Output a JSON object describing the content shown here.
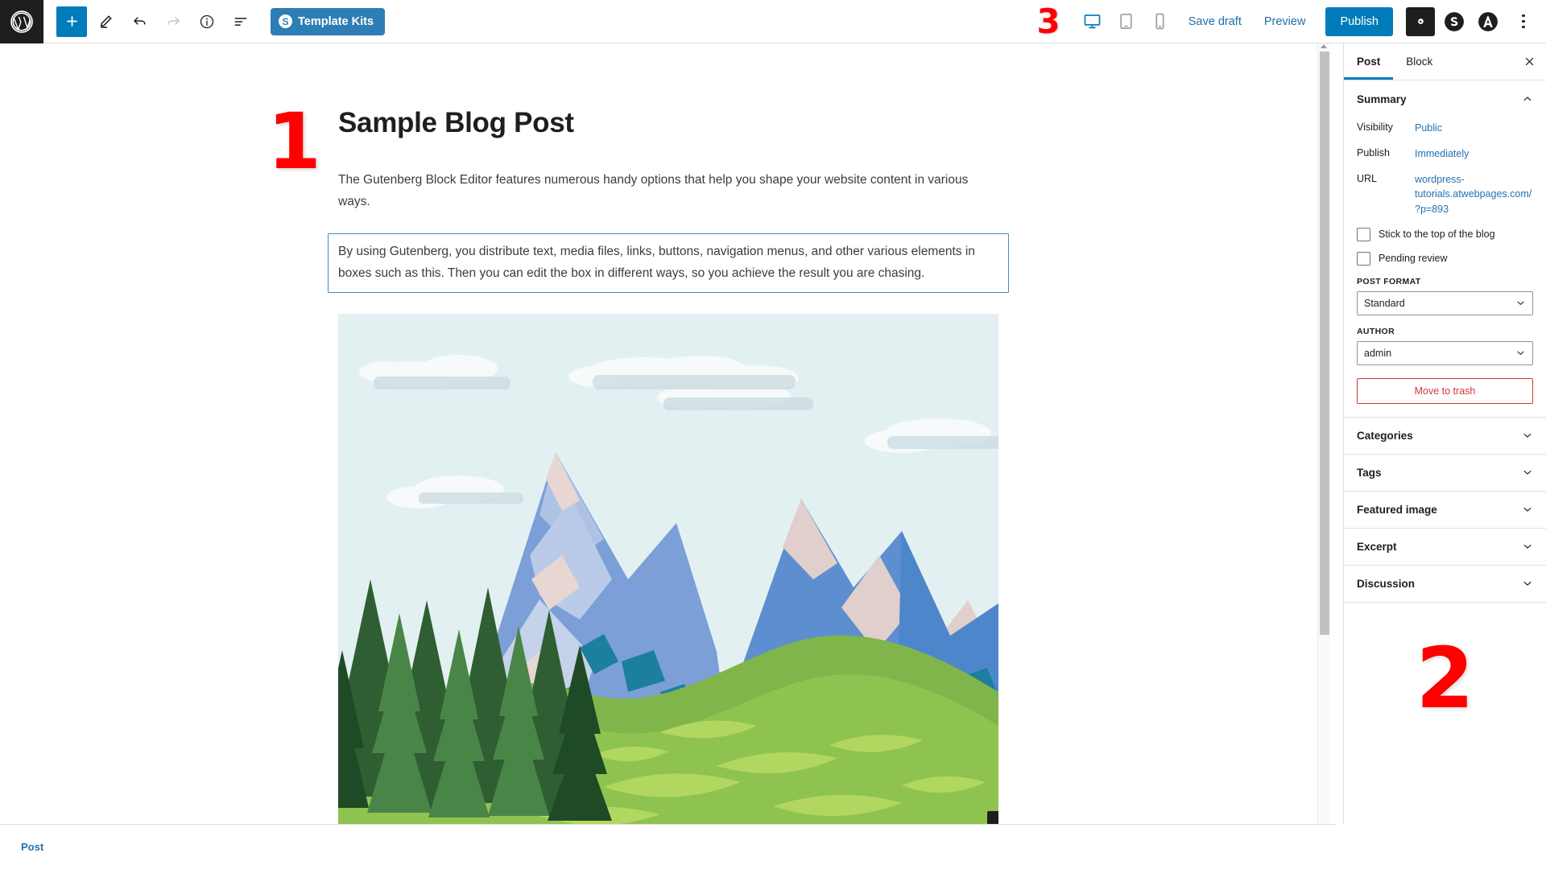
{
  "toolbar": {
    "logo_icon": "wordpress-logo-icon",
    "add_block_label": "+",
    "tools": [
      {
        "name": "add-block-button",
        "icon": "plus-icon"
      },
      {
        "name": "edit-tool-button",
        "icon": "pencil-icon"
      },
      {
        "name": "undo-button",
        "icon": "undo-arrow-icon"
      },
      {
        "name": "redo-button",
        "icon": "redo-arrow-icon"
      },
      {
        "name": "details-button",
        "icon": "info-circle-icon"
      },
      {
        "name": "list-view-button",
        "icon": "list-view-icon"
      }
    ],
    "template_kits_label": "Template Kits",
    "template_kits_badge": "S",
    "annotation_3": "3",
    "device_desktop": "desktop-icon",
    "device_tablet": "tablet-icon",
    "device_mobile": "mobile-icon",
    "save_draft_label": "Save draft",
    "preview_label": "Preview",
    "publish_label": "Publish",
    "settings_icon": "gear-icon",
    "stackable_icon": "stackable-s-icon",
    "astra_icon": "astra-a-icon",
    "more_options_icon": "kebab-menu-icon"
  },
  "editor": {
    "annotation_1": "1",
    "title": "Sample Blog Post",
    "paragraph_1": "The Gutenberg Block Editor features numerous handy options that help you shape your website content in various ways.",
    "paragraph_2_selected": "By using Gutenberg, you distribute text, media files, links, buttons, navigation menus, and other various elements in boxes such as this. Then you can edit the box in different ways, so you achieve the result you are chasing.",
    "image_alt": "mountain-landscape-illustration"
  },
  "sidebar": {
    "tabs": [
      {
        "label": "Post",
        "active": true
      },
      {
        "label": "Block",
        "active": false
      }
    ],
    "close_icon": "close-x-icon",
    "summary": {
      "title": "Summary",
      "collapse_icon": "chevron-up-icon",
      "rows": [
        {
          "label": "Visibility",
          "value": "Public"
        },
        {
          "label": "Publish",
          "value": "Immediately"
        },
        {
          "label": "URL",
          "value": "wordpress-tutorials.atwebpages.com/?p=893"
        }
      ],
      "checkboxes": [
        {
          "label": "Stick to the top of the blog",
          "checked": false
        },
        {
          "label": "Pending review",
          "checked": false
        }
      ],
      "post_format_label": "POST FORMAT",
      "post_format_value": "Standard",
      "author_label": "AUTHOR",
      "author_value": "admin",
      "trash_label": "Move to trash"
    },
    "panels": [
      {
        "label": "Categories",
        "icon": "chevron-down-icon"
      },
      {
        "label": "Tags",
        "icon": "chevron-down-icon"
      },
      {
        "label": "Featured image",
        "icon": "chevron-down-icon"
      },
      {
        "label": "Excerpt",
        "icon": "chevron-down-icon"
      },
      {
        "label": "Discussion",
        "icon": "chevron-down-icon"
      }
    ],
    "annotation_2": "2"
  },
  "footer": {
    "breadcrumb": "Post"
  },
  "colors": {
    "wp_blue": "#007cba",
    "link_blue": "#2271b1",
    "annotation_red": "#ff0000",
    "trash_red": "#d63638",
    "template_kits_blue": "#2d7eb4",
    "sky": "#e3f0f2"
  }
}
